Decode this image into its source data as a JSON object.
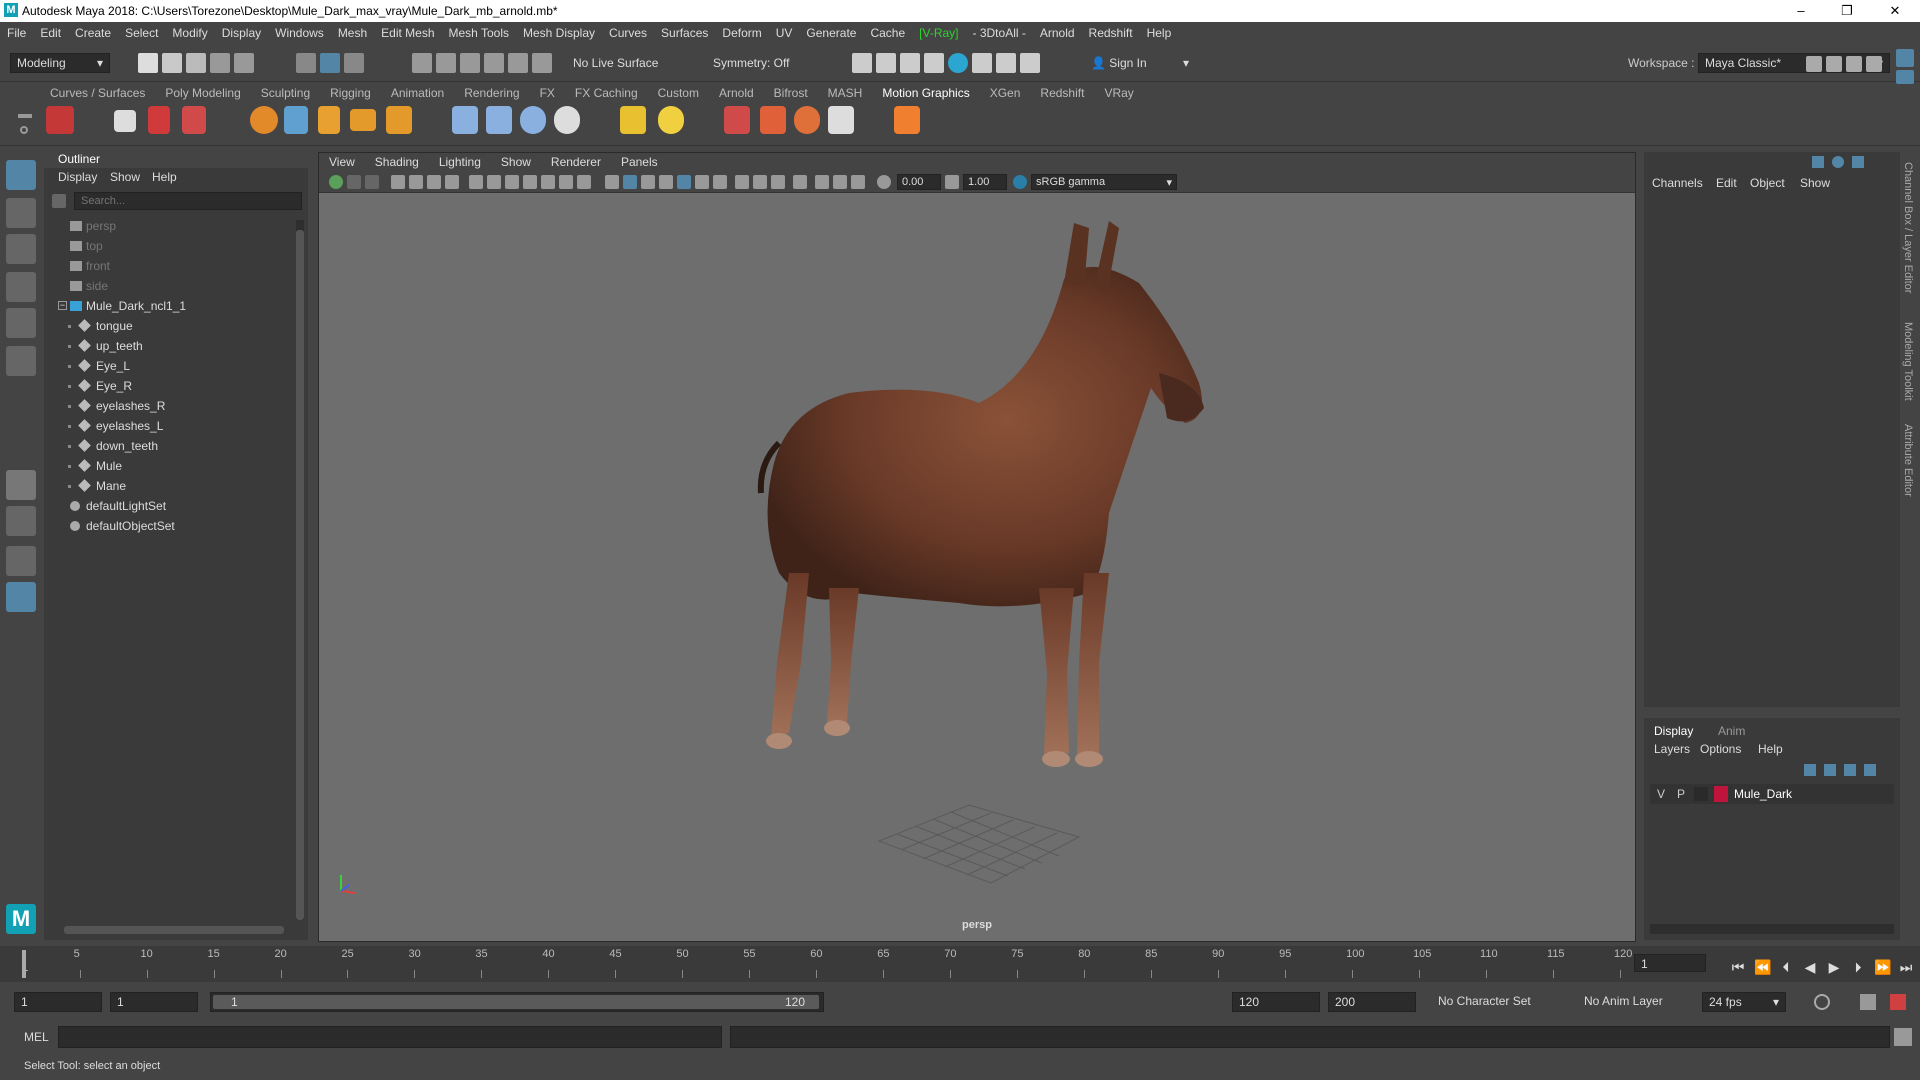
{
  "window": {
    "title": "Autodesk Maya 2018: C:\\Users\\Torezone\\Desktop\\Mule_Dark_max_vray\\Mule_Dark_mb_arnold.mb*",
    "minimize": "–",
    "maximize": "❐",
    "close": "✕"
  },
  "menubar": [
    "File",
    "Edit",
    "Create",
    "Select",
    "Modify",
    "Display",
    "Windows",
    "Mesh",
    "Edit Mesh",
    "Mesh Tools",
    "Mesh Display",
    "Curves",
    "Surfaces",
    "Deform",
    "UV",
    "Generate",
    "Cache",
    "[V-Ray]",
    "- 3DtoAll -",
    "Arnold",
    "Redshift",
    "Help"
  ],
  "status": {
    "mode": "Modeling",
    "live_surface": "No Live Surface",
    "symmetry": "Symmetry: Off",
    "sign_in": "Sign In",
    "workspace_label": "Workspace :",
    "workspace_value": "Maya Classic*"
  },
  "shelf_tabs": [
    "Curves / Surfaces",
    "Poly Modeling",
    "Sculpting",
    "Rigging",
    "Animation",
    "Rendering",
    "FX",
    "FX Caching",
    "Custom",
    "Arnold",
    "Bifrost",
    "MASH",
    "Motion Graphics",
    "XGen",
    "Redshift",
    "VRay"
  ],
  "shelf_active": "Motion Graphics",
  "outliner": {
    "title": "Outliner",
    "menu": [
      "Display",
      "Show",
      "Help"
    ],
    "search_placeholder": "Search...",
    "rows": [
      {
        "label": "persp",
        "type": "camera",
        "indent": 0,
        "dim": true
      },
      {
        "label": "top",
        "type": "camera",
        "indent": 0,
        "dim": true
      },
      {
        "label": "front",
        "type": "camera",
        "indent": 0,
        "dim": true
      },
      {
        "label": "side",
        "type": "camera",
        "indent": 0,
        "dim": true
      },
      {
        "label": "Mule_Dark_ncl1_1",
        "type": "group",
        "indent": 0,
        "dim": false
      },
      {
        "label": "tongue",
        "type": "mesh",
        "indent": 1,
        "dim": false
      },
      {
        "label": "up_teeth",
        "type": "mesh",
        "indent": 1,
        "dim": false
      },
      {
        "label": "Eye_L",
        "type": "mesh",
        "indent": 1,
        "dim": false
      },
      {
        "label": "Eye_R",
        "type": "mesh",
        "indent": 1,
        "dim": false
      },
      {
        "label": "eyelashes_R",
        "type": "mesh",
        "indent": 1,
        "dim": false
      },
      {
        "label": "eyelashes_L",
        "type": "mesh",
        "indent": 1,
        "dim": false
      },
      {
        "label": "down_teeth",
        "type": "mesh",
        "indent": 1,
        "dim": false
      },
      {
        "label": "Mule",
        "type": "mesh",
        "indent": 1,
        "dim": false
      },
      {
        "label": "Mane",
        "type": "mesh",
        "indent": 1,
        "dim": false
      },
      {
        "label": "defaultLightSet",
        "type": "set",
        "indent": 0,
        "dim": false
      },
      {
        "label": "defaultObjectSet",
        "type": "set",
        "indent": 0,
        "dim": false
      }
    ]
  },
  "viewport": {
    "menu": [
      "View",
      "Shading",
      "Lighting",
      "Show",
      "Renderer",
      "Panels"
    ],
    "field1": "0.00",
    "field2": "1.00",
    "colorspace": "sRGB gamma",
    "camera": "persp"
  },
  "channel_box": {
    "menu": [
      "Channels",
      "Edit",
      "Object",
      "Show"
    ]
  },
  "layer_editor": {
    "tabs": [
      "Display",
      "Anim"
    ],
    "menu": [
      "Layers",
      "Options",
      "Help"
    ],
    "layer": {
      "v": "V",
      "p": "P",
      "name": "Mule_Dark",
      "color": "#c0143c"
    }
  },
  "right_strip": [
    "Channel Box / Layer Editor",
    "Modeling Toolkit",
    "Attribute Editor"
  ],
  "timeline": {
    "ticks": [
      "5",
      "10",
      "15",
      "20",
      "25",
      "30",
      "35",
      "40",
      "45",
      "50",
      "55",
      "60",
      "65",
      "70",
      "75",
      "80",
      "85",
      "90",
      "95",
      "100",
      "105",
      "110",
      "115",
      "120"
    ],
    "start_marker": "1",
    "current_frame": "1"
  },
  "range": {
    "start": "1",
    "playback_start": "1",
    "slider_start": "1",
    "slider_end": "120",
    "playback_end": "120",
    "end": "200",
    "character_set": "No Character Set",
    "anim_layer": "No Anim Layer",
    "fps": "24 fps"
  },
  "cmd": {
    "label": "MEL"
  },
  "helpline": "Select Tool: select an object",
  "colors": {
    "accent": "#5285a6",
    "maya_logo": "#12a0b4",
    "vray": "#2fd12f"
  }
}
